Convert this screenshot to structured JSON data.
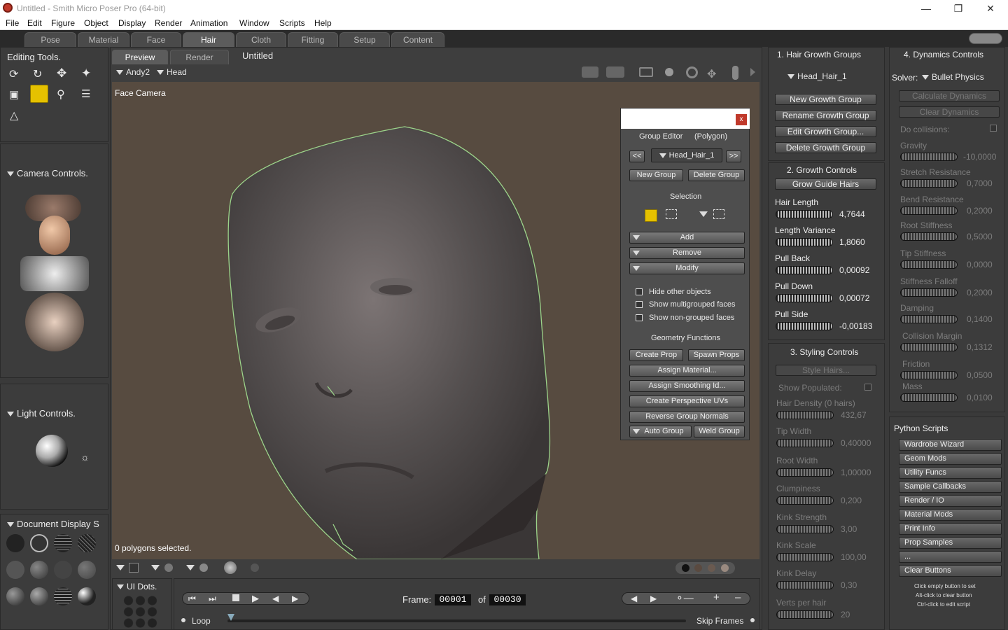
{
  "window": {
    "title": "Untitled - Smith Micro Poser Pro  (64-bit)"
  },
  "menu": [
    "File",
    "Edit",
    "Figure",
    "Object",
    "Display",
    "Render",
    "Animation",
    "Window",
    "Scripts",
    "Help"
  ],
  "rooms": [
    "Pose",
    "Material",
    "Face",
    "Hair",
    "Cloth",
    "Fitting",
    "Setup",
    "Content"
  ],
  "active_room": "Hair",
  "editing_tools": {
    "title": "Editing Tools."
  },
  "camera_controls": {
    "title": "Camera Controls."
  },
  "light_controls": {
    "title": "Light Controls."
  },
  "document_display": {
    "title": "Document Display S"
  },
  "ui_dots": {
    "title": "UI Dots."
  },
  "doc": {
    "tabs": [
      "Preview",
      "Render"
    ],
    "doc_title": "Untitled",
    "figure": "Andy2",
    "actor": "Head",
    "camera_label": "Face Camera",
    "status": "0 polygons selected."
  },
  "group_editor": {
    "close": "x",
    "title": "Group Editor",
    "mode": "(Polygon)",
    "prev": "<<",
    "next": ">>",
    "group": "Head_Hair_1",
    "new_group": "New Group",
    "delete_group": "Delete Group",
    "selection_label": "Selection",
    "add": "Add",
    "remove": "Remove",
    "modify": "Modify",
    "hide_other": "Hide other objects",
    "show_multi": "Show multigrouped faces",
    "show_non": "Show non-grouped faces",
    "geometry_label": "Geometry Functions",
    "create_prop": "Create Prop",
    "spawn_props": "Spawn Props",
    "assign_material": "Assign Material...",
    "assign_smoothing": "Assign Smoothing Id...",
    "create_uvs": "Create Perspective UVs",
    "reverse_normals": "Reverse Group Normals",
    "auto_group": "Auto Group",
    "weld_group": "Weld Group"
  },
  "timeline": {
    "frame_label": "Frame:",
    "frame": "00001",
    "of_label": "of",
    "total": "00030",
    "loop": "Loop",
    "skip_frames": "Skip Frames"
  },
  "hair_growth": {
    "title": "1. Hair Growth Groups",
    "group": "Head_Hair_1",
    "buttons": [
      "New Growth Group",
      "Rename Growth Group",
      "Edit Growth Group...",
      "Delete Growth Group"
    ]
  },
  "growth_controls": {
    "title": "2. Growth Controls",
    "grow_btn": "Grow Guide Hairs",
    "params": [
      {
        "label": "Hair Length",
        "value": "4,7644"
      },
      {
        "label": "Length Variance",
        "value": "1,8060"
      },
      {
        "label": "Pull Back",
        "value": "0,00092"
      },
      {
        "label": "Pull Down",
        "value": "0,00072"
      },
      {
        "label": "Pull Side",
        "value": "-0,00183"
      }
    ]
  },
  "styling_controls": {
    "title": "3. Styling Controls",
    "style_btn": "Style Hairs...",
    "show_populated": "Show Populated:",
    "params": [
      {
        "label": "Hair Density  (0 hairs)",
        "value": "432,67"
      },
      {
        "label": "Tip Width",
        "value": "0,40000"
      },
      {
        "label": "Root Width",
        "value": "1,00000"
      },
      {
        "label": "Clumpiness",
        "value": "0,200"
      },
      {
        "label": "Kink Strength",
        "value": "3,00"
      },
      {
        "label": "Kink Scale",
        "value": "100,00"
      },
      {
        "label": "Kink Delay",
        "value": "0,30"
      },
      {
        "label": "Verts per hair",
        "value": "20"
      }
    ]
  },
  "dynamics": {
    "title": "4. Dynamics Controls",
    "solver_label": "Solver:",
    "solver": "Bullet Physics",
    "calc_btn": "Calculate Dynamics",
    "clear_btn": "Clear Dynamics",
    "collisions": "Do collisions:",
    "params": [
      {
        "label": "Gravity",
        "value": "-10,0000"
      },
      {
        "label": "Stretch Resistance",
        "value": "0,7000"
      },
      {
        "label": "Bend Resistance",
        "value": "0,2000"
      },
      {
        "label": "Root Stiffness",
        "value": "0,5000"
      },
      {
        "label": "Tip Stiffness",
        "value": "0,0000"
      },
      {
        "label": "Stiffness Falloff",
        "value": "0,2000"
      },
      {
        "label": "Damping",
        "value": "0,1400"
      },
      {
        "label": "Collision Margin",
        "value": "0,1312"
      },
      {
        "label": "Friction",
        "value": "0,0500"
      },
      {
        "label": "Mass",
        "value": "0,0100"
      }
    ]
  },
  "python": {
    "title": "Python Scripts",
    "buttons": [
      "Wardrobe Wizard",
      "Geom Mods",
      "Utility Funcs",
      "Sample Callbacks",
      "Render / IO",
      "Material Mods",
      "Print Info",
      "Prop Samples",
      "...",
      "Clear Buttons"
    ],
    "hint1": "Click empty button to set",
    "hint2": "Alt-click to clear button",
    "hint3": "Ctrl-click to edit script"
  }
}
